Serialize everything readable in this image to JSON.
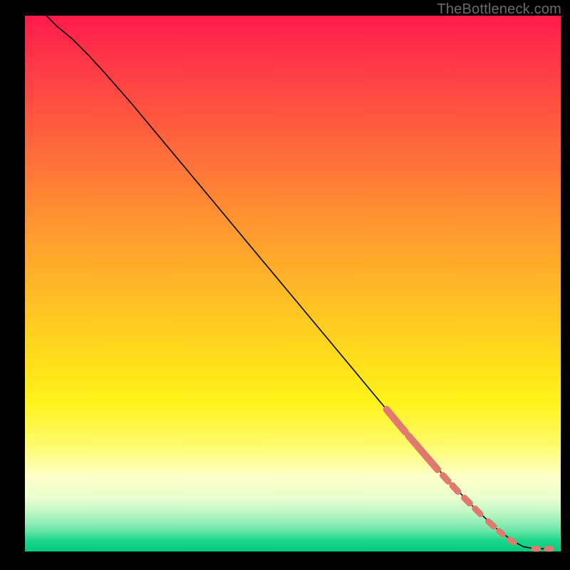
{
  "attribution": "TheBottleneck.com",
  "colors": {
    "dot_fill": "#e07a6f",
    "dot_stroke": "#c95b52",
    "curve": "#000000"
  },
  "chart_data": {
    "type": "line",
    "title": "",
    "xlabel": "",
    "ylabel": "",
    "xlim": [
      0,
      100
    ],
    "ylim": [
      0,
      100
    ],
    "grid": false,
    "legend": false,
    "curve": [
      {
        "x": 4,
        "y": 100
      },
      {
        "x": 6,
        "y": 98
      },
      {
        "x": 9,
        "y": 95.5
      },
      {
        "x": 12,
        "y": 92.5
      },
      {
        "x": 15,
        "y": 89.2
      },
      {
        "x": 20,
        "y": 83.5
      },
      {
        "x": 25,
        "y": 77.5
      },
      {
        "x": 30,
        "y": 71.5
      },
      {
        "x": 35,
        "y": 65.5
      },
      {
        "x": 40,
        "y": 59.5
      },
      {
        "x": 45,
        "y": 53.5
      },
      {
        "x": 50,
        "y": 47.5
      },
      {
        "x": 55,
        "y": 41.5
      },
      {
        "x": 60,
        "y": 35.5
      },
      {
        "x": 65,
        "y": 29.5
      },
      {
        "x": 70,
        "y": 23.5
      },
      {
        "x": 75,
        "y": 17.7
      },
      {
        "x": 80,
        "y": 12.2
      },
      {
        "x": 84,
        "y": 8.0
      },
      {
        "x": 88,
        "y": 4.3
      },
      {
        "x": 91,
        "y": 2.0
      },
      {
        "x": 93,
        "y": 0.9
      },
      {
        "x": 95,
        "y": 0.5
      },
      {
        "x": 96,
        "y": 0.5
      },
      {
        "x": 97,
        "y": 0.5
      },
      {
        "x": 98,
        "y": 0.5
      }
    ],
    "dot_clusters": [
      {
        "x0": 67.5,
        "y0": 26.5,
        "x1": 71.0,
        "y1": 22.3,
        "r": 5.0
      },
      {
        "x0": 71.6,
        "y0": 21.6,
        "x1": 77.0,
        "y1": 15.3,
        "r": 5.0
      },
      {
        "x0": 78.0,
        "y0": 14.2,
        "x1": 79.0,
        "y1": 13.1,
        "r": 4.6
      },
      {
        "x0": 79.8,
        "y0": 12.3,
        "x1": 80.8,
        "y1": 11.2,
        "r": 4.6
      },
      {
        "x0": 82.0,
        "y0": 10.0,
        "x1": 83.0,
        "y1": 9.0,
        "r": 4.6
      },
      {
        "x0": 84.0,
        "y0": 8.0,
        "x1": 85.0,
        "y1": 7.0,
        "r": 4.4
      },
      {
        "x0": 86.5,
        "y0": 5.6,
        "x1": 87.5,
        "y1": 4.7,
        "r": 4.4
      },
      {
        "x0": 88.5,
        "y0": 3.8,
        "x1": 89.2,
        "y1": 3.2,
        "r": 4.2
      },
      {
        "x0": 90.5,
        "y0": 2.2,
        "x1": 91.3,
        "y1": 1.7,
        "r": 4.2
      },
      {
        "x0": 95.0,
        "y0": 0.5,
        "x1": 95.8,
        "y1": 0.5,
        "r": 4.0
      },
      {
        "x0": 97.4,
        "y0": 0.5,
        "x1": 98.2,
        "y1": 0.5,
        "r": 4.0
      }
    ]
  }
}
